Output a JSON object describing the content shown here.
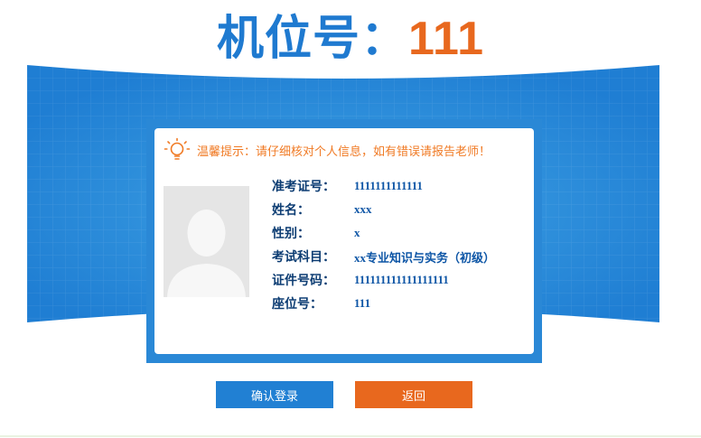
{
  "header": {
    "label": "机位号：",
    "seat_number": "111"
  },
  "notice": {
    "text": "温馨提示：请仔细核对个人信息，如有错误请报告老师！"
  },
  "candidate": {
    "fields": [
      {
        "key": "准考证号：",
        "value": "1111111111111"
      },
      {
        "key": "姓名：",
        "value": "xxx"
      },
      {
        "key": "性别：",
        "value": "x"
      },
      {
        "key": "考试科目：",
        "value": "xx专业知识与实务（初级）"
      },
      {
        "key": "证件号码：",
        "value": "111111111111111111"
      },
      {
        "key": "座位号：",
        "value": "111"
      }
    ]
  },
  "actions": {
    "confirm_label": "确认登录",
    "back_label": "返回"
  },
  "colors": {
    "primary_blue": "#2180d3",
    "accent_orange": "#e8681e",
    "tip_orange": "#f07a24"
  }
}
